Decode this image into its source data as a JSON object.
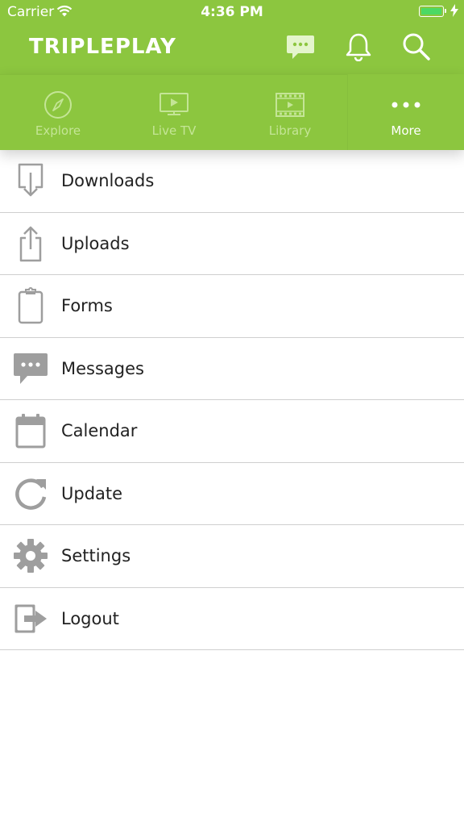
{
  "status_bar": {
    "carrier": "Carrier",
    "time": "4:36 PM",
    "battery_level": 1.0
  },
  "app": {
    "logo_text": "TRIPLEPLAY"
  },
  "header_icons": [
    "chat-icon",
    "bell-icon",
    "search-icon"
  ],
  "tabs": [
    {
      "label": "Explore",
      "icon": "compass-icon",
      "active": false
    },
    {
      "label": "Live TV",
      "icon": "tv-icon",
      "active": false
    },
    {
      "label": "Library",
      "icon": "film-icon",
      "active": false
    },
    {
      "label": "More",
      "icon": "more-icon",
      "active": true
    }
  ],
  "menu": [
    {
      "label": "Downloads",
      "icon": "download-icon"
    },
    {
      "label": "Uploads",
      "icon": "upload-icon"
    },
    {
      "label": "Forms",
      "icon": "clipboard-icon"
    },
    {
      "label": "Messages",
      "icon": "message-icon"
    },
    {
      "label": "Calendar",
      "icon": "calendar-icon"
    },
    {
      "label": "Update",
      "icon": "refresh-icon"
    },
    {
      "label": "Settings",
      "icon": "gear-icon"
    },
    {
      "label": "Logout",
      "icon": "logout-icon"
    }
  ],
  "colors": {
    "accent": "#8cc63f",
    "icon_gray": "#9e9e9e",
    "tab_inactive": "#c4e596",
    "battery": "#4cd964"
  }
}
